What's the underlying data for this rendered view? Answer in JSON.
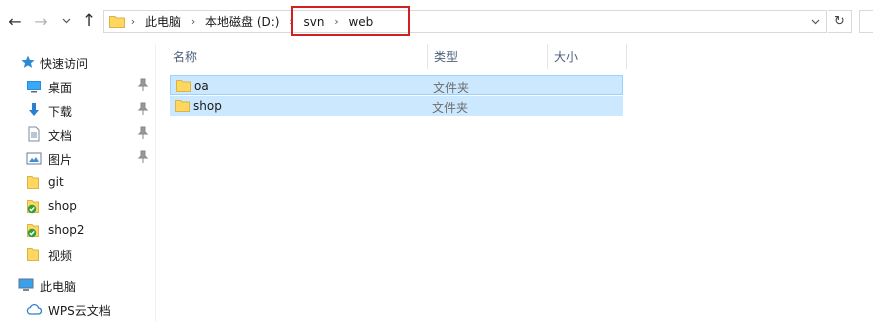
{
  "window": {
    "title": "web"
  },
  "nav_buttons": {
    "back": "back-arrow-icon",
    "forward": "forward-arrow-icon",
    "recent": "chevron-down-icon",
    "up": "up-arrow-icon"
  },
  "address_bar": {
    "breadcrumbs": [
      {
        "label": "此电脑"
      },
      {
        "label": "本地磁盘 (D:)"
      },
      {
        "label": "svn"
      },
      {
        "label": "web"
      }
    ]
  },
  "navigation_pane": {
    "quick_access": {
      "label": "快速访问"
    },
    "items": [
      {
        "label": "桌面",
        "icon": "desktop-icon",
        "pinned": true
      },
      {
        "label": "下载",
        "icon": "download-icon",
        "pinned": true
      },
      {
        "label": "文档",
        "icon": "document-icon",
        "pinned": true
      },
      {
        "label": "图片",
        "icon": "pictures-icon",
        "pinned": true
      },
      {
        "label": "git",
        "icon": "folder-icon",
        "pinned": false
      },
      {
        "label": "shop",
        "icon": "svn-folder-icon",
        "pinned": false
      },
      {
        "label": "shop2",
        "icon": "svn-folder-icon",
        "pinned": false
      },
      {
        "label": "视频",
        "icon": "folder-icon",
        "pinned": false
      }
    ],
    "this_pc": {
      "label": "此电脑"
    },
    "wps_cloud": {
      "label": "WPS云文档"
    }
  },
  "file_list": {
    "columns": {
      "name": "名称",
      "type": "类型",
      "size": "大小"
    },
    "rows": [
      {
        "name": "oa",
        "type": "文件夹",
        "size": ""
      },
      {
        "name": "shop",
        "type": "文件夹",
        "size": ""
      }
    ]
  },
  "colors": {
    "selection": "#cce8ff",
    "highlight_box": "#d21f1f",
    "folder": "#ffd75e"
  }
}
